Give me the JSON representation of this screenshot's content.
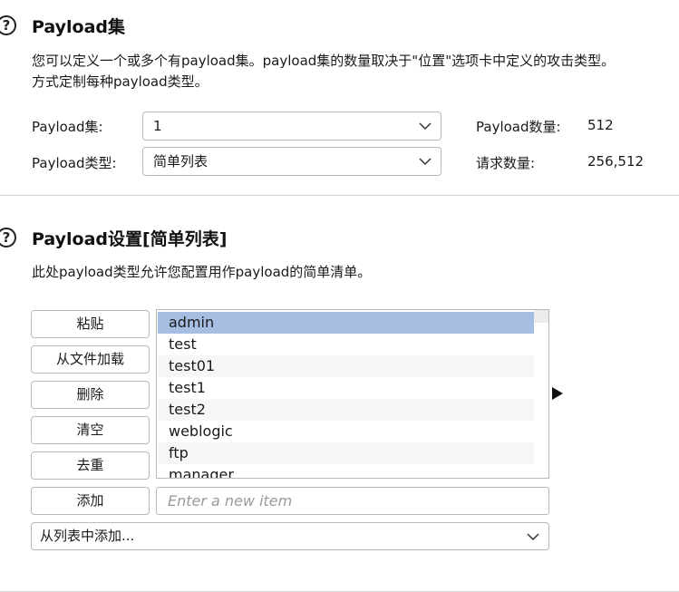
{
  "payload_sets": {
    "title": "Payload集",
    "description_line1": "您可以定义一个或多个有payload集。payload集的数量取决于\"位置\"选项卡中定义的攻击类型。",
    "description_line2": "方式定制每种payload类型。",
    "set_label": "Payload集:",
    "set_value": "1",
    "type_label": "Payload类型:",
    "type_value": "简单列表",
    "count_label": "Payload数量:",
    "count_value": "512",
    "requests_label": "请求数量:",
    "requests_value": "256,512"
  },
  "payload_settings": {
    "title": "Payload设置[简单列表]",
    "description": "此处payload类型允许您配置用作payload的简单清单。",
    "buttons": {
      "paste": "粘贴",
      "load": "从文件加载",
      "remove": "删除",
      "clear": "清空",
      "dedupe": "去重",
      "add": "添加"
    },
    "items": [
      "admin",
      "test",
      "test01",
      "test1",
      "test2",
      "weblogic",
      "ftp",
      "manager"
    ],
    "selected_index": 0,
    "new_item_placeholder": "Enter a new item",
    "add_from_list": "从列表中添加..."
  },
  "icons": {
    "help": "help-circle-icon",
    "dropdown": "chevron-down-icon",
    "expand": "triangle-right-icon"
  },
  "colors": {
    "selected_row": "#a7bee3",
    "border": "#b9b9b9"
  }
}
